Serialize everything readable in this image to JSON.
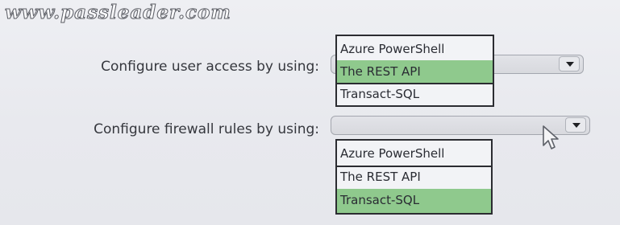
{
  "watermark": "www.passleader.com",
  "rows": [
    {
      "label": "Configure user access by using:",
      "options": [
        "Azure PowerShell",
        "The REST API",
        "Transact-SQL"
      ],
      "selected": "The REST API"
    },
    {
      "label": "Configure firewall rules by using:",
      "options": [
        "Azure PowerShell",
        "The REST API",
        "Transact-SQL"
      ],
      "selected": "Transact-SQL"
    }
  ],
  "colors": {
    "selected_highlight": "#8fc98d",
    "background": "#e9eaef",
    "border": "#2b2c31"
  },
  "icons": {
    "dropdown": "chevron-down-icon",
    "pointer": "mouse-pointer-icon"
  }
}
